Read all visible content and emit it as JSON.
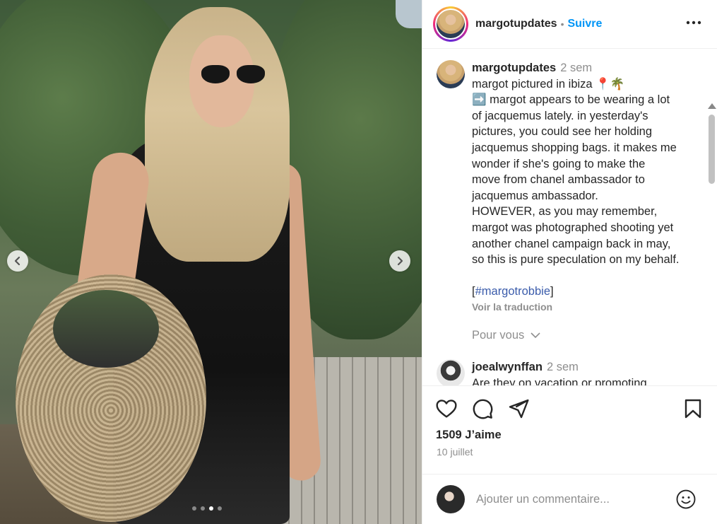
{
  "post": {
    "image_alt": "",
    "carousel": {
      "total": 4,
      "active_index": 2
    }
  },
  "header": {
    "username": "margotupdates",
    "separator": "•",
    "follow_label": "Suivre",
    "more_label": "•••"
  },
  "caption": {
    "username": "margotupdates",
    "time": "2 sem",
    "lines": [
      "margot pictured in ibiza 📍🌴",
      "➡️ margot appears to be wearing a lot",
      "of jacquemus lately. in yesterday's",
      "pictures, you could see her holding",
      "jacquemus shopping bags. it makes me",
      "wonder if she's going to make the",
      "move from chanel ambassador to",
      "jacquemus ambassador.",
      "HOWEVER, as you may remember,",
      "margot was photographed shooting yet",
      "another chanel campaign back in may,",
      "so this is pure speculation on my behalf."
    ],
    "hashtag_open": "[",
    "hashtag": "#margotrobbie",
    "hashtag_close": "]",
    "see_translation": "Voir la traduction"
  },
  "pour_vous": "Pour vous",
  "comment": {
    "username": "joealwynffan",
    "time": "2 sem",
    "text": "Are they on vacation or promoting"
  },
  "likes": "1509 J’aime",
  "date": "10 juillet",
  "add_comment": {
    "placeholder": "Ajouter un commentaire..."
  },
  "icons": {
    "like": "heart-icon",
    "comment": "comment-icon",
    "share": "send-icon",
    "save": "bookmark-icon",
    "emoji": "smiley-icon",
    "prev": "chevron-left-icon",
    "next": "chevron-right-icon"
  },
  "colors": {
    "follow": "#0095f6",
    "hashtag": "#3b5cab",
    "muted": "#8e8e8e"
  }
}
